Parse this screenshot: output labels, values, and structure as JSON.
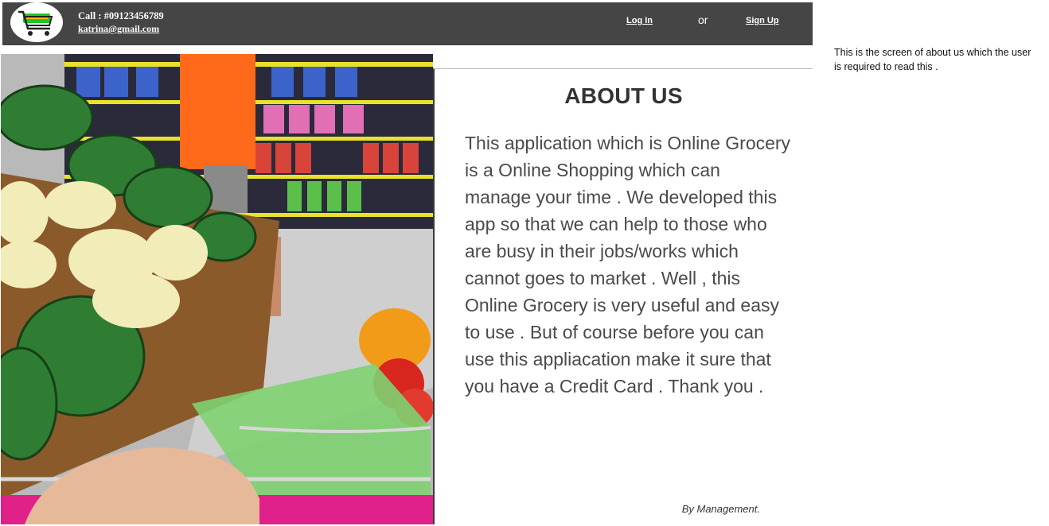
{
  "header": {
    "phone": "Call : #09123456789",
    "email": "katrina@gmail.com",
    "login_label": "Log In",
    "or_label": "or",
    "signup_label": "Sign Up"
  },
  "about": {
    "title": "ABOUT US",
    "body": "This application which is Online Grocery is a Online Shopping which can manage your time . We developed this app so that we can help to those who are busy in their jobs/works which cannot goes to market . Well , this Online Grocery is very useful and easy to use . But of course before you can use this appliacation make it sure that you have a Credit Card . Thank you .",
    "signature": "By Management."
  },
  "annotation": {
    "text": "This is the screen of about us which the user is required to read this ."
  },
  "colors": {
    "header_bg": "#454545",
    "card_bg": "#ffffff",
    "text_dark": "#333333",
    "cart_pink": "#e0218a"
  }
}
